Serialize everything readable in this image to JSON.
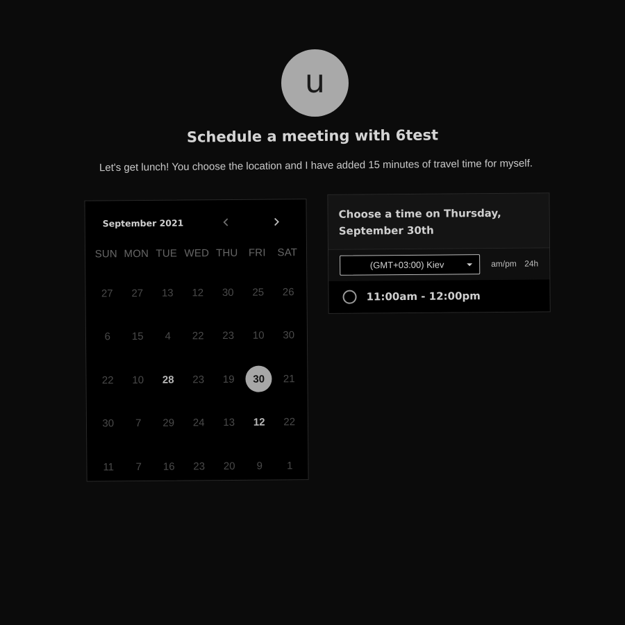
{
  "host": {
    "avatar_initial": "u",
    "title": "Schedule a meeting with 6test",
    "description": "Let's get lunch! You choose the location and I have added 15 minutes of travel time for myself."
  },
  "calendar": {
    "month_label": "September 2021",
    "prev_icon": "chevron-left-icon",
    "next_icon": "chevron-right-icon",
    "weekdays": [
      "SUN",
      "MON",
      "TUE",
      "WED",
      "THU",
      "FRI",
      "SAT"
    ],
    "days": [
      {
        "label": "27",
        "state": "unavailable"
      },
      {
        "label": "27",
        "state": "unavailable"
      },
      {
        "label": "13",
        "state": "unavailable"
      },
      {
        "label": "12",
        "state": "available"
      },
      {
        "label": "30",
        "state": "unavailable"
      },
      {
        "label": "25",
        "state": "unavailable"
      },
      {
        "label": "26",
        "state": "unavailable"
      },
      {
        "label": "6",
        "state": "unavailable"
      },
      {
        "label": "15",
        "state": "unavailable"
      },
      {
        "label": "4",
        "state": "available"
      },
      {
        "label": "22",
        "state": "unavailable"
      },
      {
        "label": "23",
        "state": "available"
      },
      {
        "label": "10",
        "state": "unavailable"
      },
      {
        "label": "30",
        "state": "unavailable"
      },
      {
        "label": "22",
        "state": "unavailable"
      },
      {
        "label": "10",
        "state": "unavailable"
      },
      {
        "label": "28",
        "state": "bold"
      },
      {
        "label": "23",
        "state": "unavailable"
      },
      {
        "label": "19",
        "state": "available"
      },
      {
        "label": "30",
        "state": "selected"
      },
      {
        "label": "21",
        "state": "unavailable"
      },
      {
        "label": "30",
        "state": "unavailable"
      },
      {
        "label": "7",
        "state": "unavailable"
      },
      {
        "label": "29",
        "state": "unavailable"
      },
      {
        "label": "24",
        "state": "available"
      },
      {
        "label": "13",
        "state": "unavailable"
      },
      {
        "label": "12",
        "state": "bold"
      },
      {
        "label": "22",
        "state": "unavailable"
      },
      {
        "label": "11",
        "state": "unavailable"
      },
      {
        "label": "7",
        "state": "unavailable"
      },
      {
        "label": "16",
        "state": "unavailable"
      },
      {
        "label": "23",
        "state": "unavailable"
      },
      {
        "label": "20",
        "state": "unavailable"
      },
      {
        "label": "9",
        "state": "unavailable"
      },
      {
        "label": "1",
        "state": "unavailable"
      }
    ]
  },
  "times": {
    "heading": "Choose a time on Thursday, September 30th",
    "timezone": "(GMT+03:00) Kiev",
    "format_12h": "am/pm",
    "format_24h": "24h",
    "slots": [
      {
        "label": "11:00am - 12:00pm",
        "selected": false
      }
    ]
  },
  "colors": {
    "background": "#0b0b0b",
    "avatar": "#a9a9a9",
    "available_day": "#262626",
    "selected_day": "#a7a7a7"
  }
}
